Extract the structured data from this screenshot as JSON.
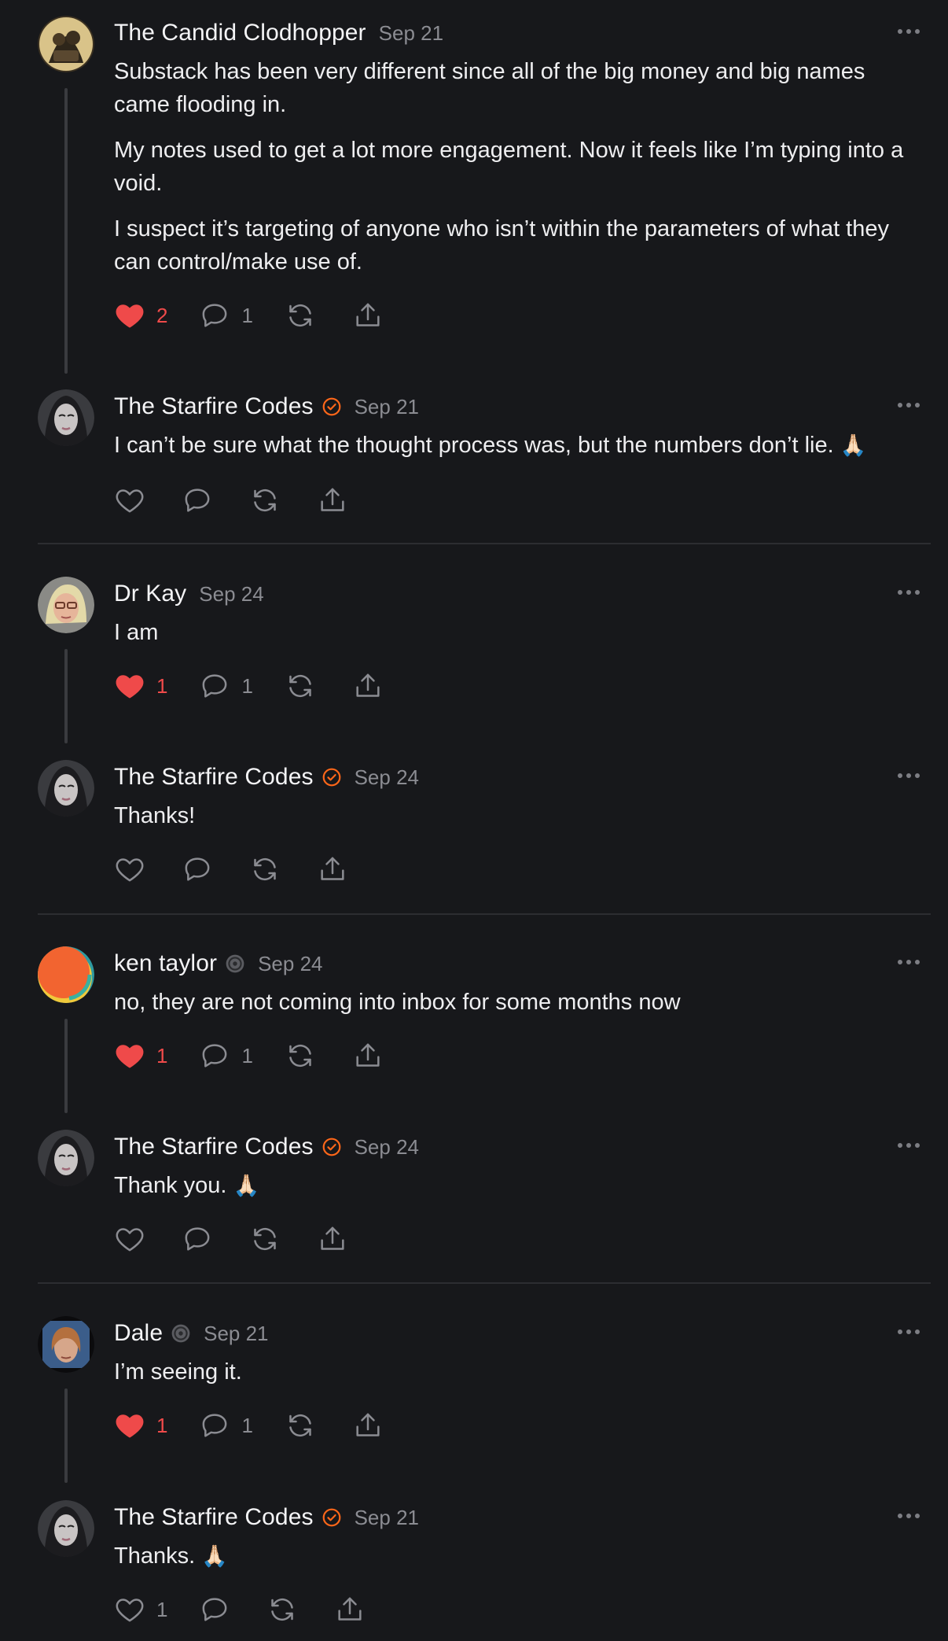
{
  "colors": {
    "background": "#17181b",
    "text": "#eeeef0",
    "muted": "#8b8c92",
    "liked": "#ef4a4a",
    "verified": "#ff6719"
  },
  "posts": [
    {
      "author": "The Candid Clodhopper",
      "date": "Sep 21",
      "badge": null,
      "paragraphs": [
        "Substack has been very different since all of the big money and big names came flooding in.",
        "My notes used to get a lot more engagement. Now it feels like I’m typing into a void.",
        "I suspect it’s targeting of anyone who isn’t within the parameters of what they can control/make use of."
      ],
      "liked": true,
      "like_count": "2",
      "comment_count": "1"
    },
    {
      "author": "The Starfire Codes",
      "date": "Sep 21",
      "badge": "verified-check",
      "paragraphs": [
        "I can’t be sure what the thought process was, but the numbers don’t lie. 🙏🏻"
      ],
      "liked": false,
      "like_count": "",
      "comment_count": ""
    },
    {
      "author": "Dr Kay",
      "date": "Sep 24",
      "badge": null,
      "paragraphs": [
        "I am"
      ],
      "liked": true,
      "like_count": "1",
      "comment_count": "1"
    },
    {
      "author": "The Starfire Codes",
      "date": "Sep 24",
      "badge": "verified-check",
      "paragraphs": [
        "Thanks!"
      ],
      "liked": false,
      "like_count": "",
      "comment_count": ""
    },
    {
      "author": "ken taylor",
      "date": "Sep 24",
      "badge": "subscriber-badge",
      "paragraphs": [
        "no, they are not coming into inbox for some months now"
      ],
      "liked": true,
      "like_count": "1",
      "comment_count": "1"
    },
    {
      "author": "The Starfire Codes",
      "date": "Sep 24",
      "badge": "verified-check",
      "paragraphs": [
        "Thank you. 🙏🏻"
      ],
      "liked": false,
      "like_count": "",
      "comment_count": ""
    },
    {
      "author": "Dale",
      "date": "Sep 21",
      "badge": "subscriber-badge",
      "paragraphs": [
        "I’m seeing it."
      ],
      "liked": true,
      "like_count": "1",
      "comment_count": "1"
    },
    {
      "author": "The Starfire Codes",
      "date": "Sep 21",
      "badge": "verified-check",
      "paragraphs": [
        "Thanks. 🙏🏻"
      ],
      "liked": false,
      "like_count": "1",
      "comment_count": ""
    }
  ]
}
